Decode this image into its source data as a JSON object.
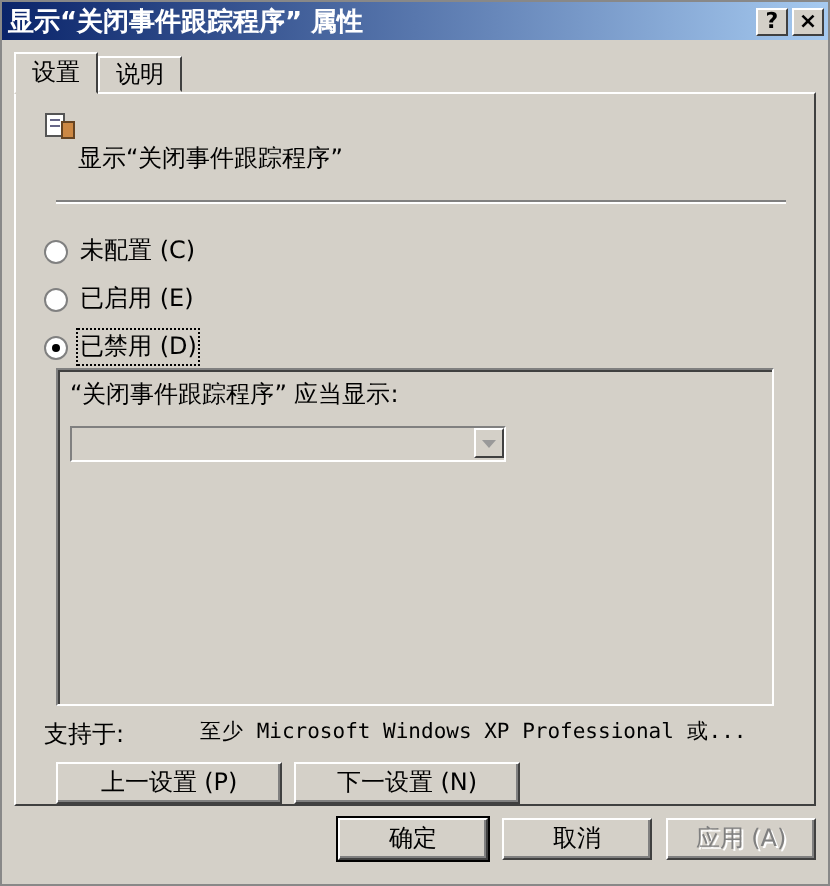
{
  "window": {
    "title": "显示“关闭事件跟踪程序” 属性",
    "title_buttons": [
      "?",
      "×"
    ]
  },
  "tabs": [
    {
      "label": "设置",
      "selected": true
    },
    {
      "label": "说明",
      "selected": false
    }
  ],
  "policy": {
    "name": "显示“关闭事件跟踪程序”"
  },
  "options": [
    {
      "label": "未配置 (C)",
      "selected": false
    },
    {
      "label": "已启用 (E)",
      "selected": false
    },
    {
      "label": "已禁用 (D)",
      "selected": true
    }
  ],
  "group": {
    "label": "“关闭事件跟踪程序” 应当显示:",
    "dropdown": {
      "disabled": true
    }
  },
  "supported": {
    "label": "支持于:",
    "value": "至少 Microsoft Windows XP Professional 或..."
  },
  "nav_buttons": [
    "上一设置 (P)",
    "下一设置 (N)"
  ],
  "buttons": [
    {
      "label": "确定",
      "default": true,
      "disabled": false
    },
    {
      "label": "取消",
      "default": false,
      "disabled": false
    },
    {
      "label": "应用 (A)",
      "default": false,
      "disabled": true
    }
  ]
}
